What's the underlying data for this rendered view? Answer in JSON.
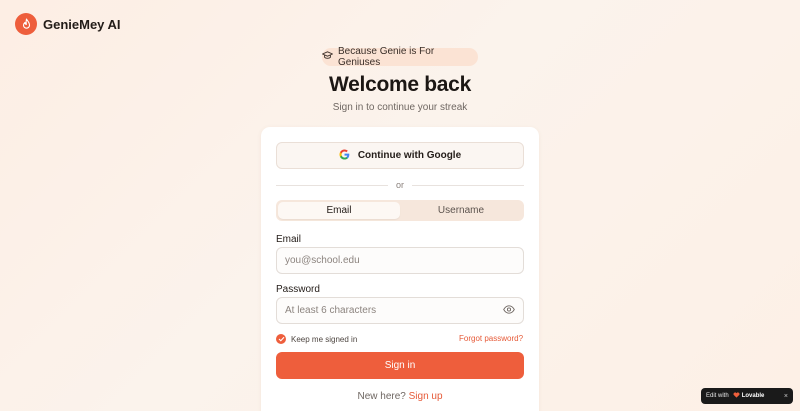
{
  "brand": {
    "name": "GenieMey AI",
    "icon": "flame-icon",
    "accent": "#ee5e3c"
  },
  "tagline": {
    "icon": "graduation-cap-icon",
    "text": "Because Genie is For Geniuses"
  },
  "heading": {
    "title": "Welcome back",
    "subtitle": "Sign in to continue your streak"
  },
  "auth": {
    "google_label": "Continue with Google",
    "divider_text": "or",
    "tabs": [
      {
        "label": "Email",
        "active": true
      },
      {
        "label": "Username",
        "active": false
      }
    ],
    "email": {
      "label": "Email",
      "placeholder": "you@school.edu"
    },
    "password": {
      "label": "Password",
      "placeholder": "At least 6 characters",
      "icon": "eye-icon"
    },
    "remember_label": "Keep me signed in",
    "remember_checked": true,
    "forgot_label": "Forgot password?",
    "submit_label": "Sign in",
    "signup_prompt": "New here?",
    "signup_link": "Sign up"
  },
  "badge": {
    "prefix": "Edit with",
    "brand": "Lovable",
    "close": "×"
  }
}
